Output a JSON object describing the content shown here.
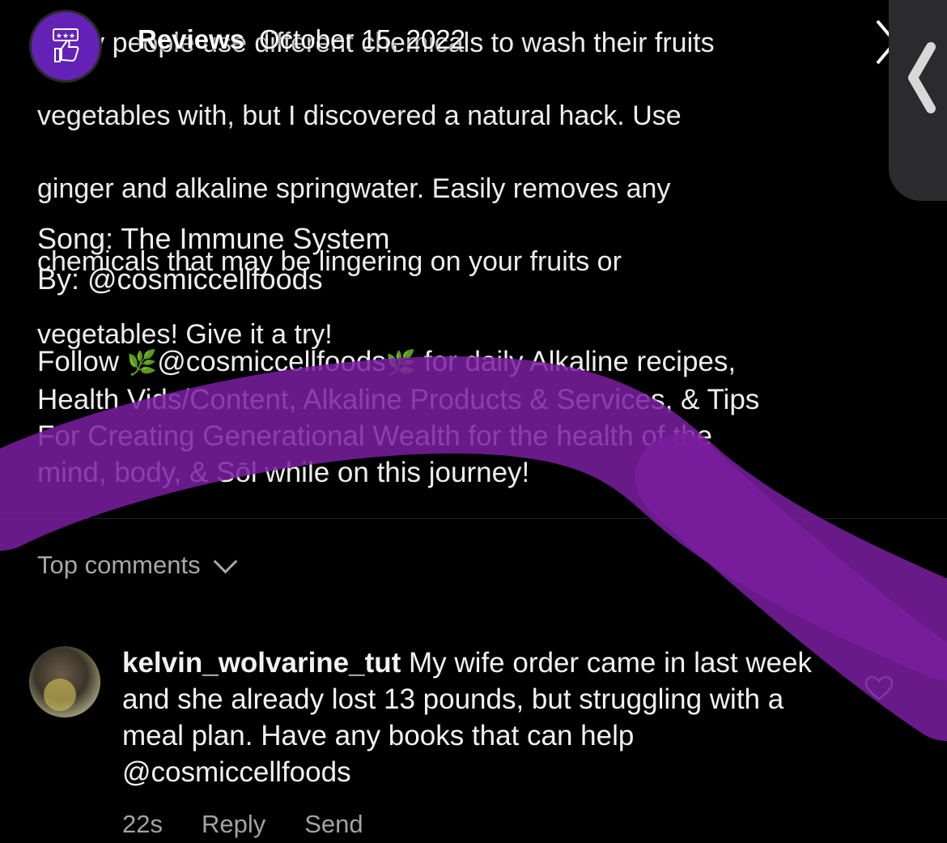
{
  "story_header": {
    "title": "Reviews",
    "date": "October 15, 2022"
  },
  "post": {
    "caption_lines": [
      "Many people use different chemicals to wash their fruits",
      "vegetables with, but I discovered a natural hack. Use",
      "ginger and alkaline springwater. Easily removes any",
      "chemicals that may be lingering on your fruits or",
      "vegetables! Give it a try!"
    ],
    "song_line": "Song: The Immune System",
    "by_line": "By: @cosmiccellfoods",
    "follow_word": "Follow",
    "follow_handle": "@cosmiccellfoods",
    "follow_rest_1": "for daily Alkaline recipes,",
    "follow_line_2": "Health Vids/Content, Alkaline Products & Services, & Tips",
    "follow_line_3": "For Creating Generational Wealth for the health of the",
    "follow_line_4": "mind, body, & Sōl while on this journey!"
  },
  "comments": {
    "section_label": "Top comments",
    "items": [
      {
        "username": "kelvin_wolvarine_tut",
        "text": "My wife order came in last week and she already lost 13 pounds, but struggling with a meal plan. Have any books that can help @cosmiccellfoods",
        "time": "22s",
        "reply_label": "Reply",
        "send_label": "Send"
      }
    ]
  },
  "icons": {
    "logo": "thumbs-up-rating-icon",
    "next": "chevron-right-icon",
    "side": "chevron-left-icon",
    "like": "heart-icon",
    "sort": "chevron-down-icon",
    "leaf": "herb-icon"
  },
  "colors": {
    "background": "#000000",
    "text": "#ededed",
    "muted": "#a7a7a7",
    "brand_purple": "#6321b5",
    "highlight_stroke": "#7a1fa0",
    "leaf": "#7cbf3a"
  }
}
